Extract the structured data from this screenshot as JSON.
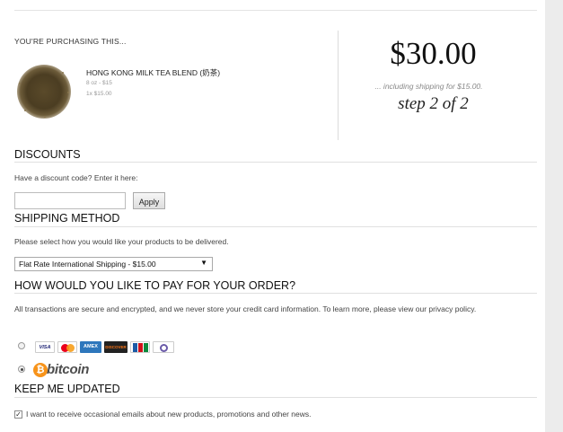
{
  "summary": {
    "heading": "YOU'RE PURCHASING THIS...",
    "product_name": "HONG KONG MILK TEA BLEND (奶茶)",
    "variant": "8 oz - $15",
    "quantity": "1x $15.00",
    "total": "$30.00",
    "shipping_note": "... including shipping for $15.00.",
    "step": "step 2 of 2"
  },
  "discounts": {
    "title": "DISCOUNTS",
    "prompt": "Have a discount code? Enter it here:",
    "input_value": "",
    "apply_label": "Apply"
  },
  "shipping": {
    "title": "SHIPPING METHOD",
    "prompt": "Please select how you would like your products to be delivered.",
    "selected_option": "Flat Rate International Shipping - $15.00"
  },
  "payment": {
    "title": "HOW WOULD YOU LIKE TO PAY FOR YOUR ORDER?",
    "note": "All transactions are secure and encrypted, and we never store your credit card information. To learn more, please view our privacy policy.",
    "options": [
      {
        "id": "credit-card",
        "selected": false,
        "cards": [
          "VISA",
          "MasterCard",
          "AMEX",
          "DISCOVER",
          "JCB",
          "Diners Club"
        ]
      },
      {
        "id": "bitcoin",
        "selected": true,
        "label": "bitcoin",
        "symbol": "₿"
      }
    ],
    "card_colors": {
      "visa": "#1a1f71",
      "mastercard_red": "#eb001b",
      "mastercard_yellow": "#f79e1b",
      "amex": "#2e77bc",
      "discover": "#f47216",
      "jcb_red": "#d0121b",
      "diners": "#6a5aa8"
    },
    "bitcoin_color": "#f7931a"
  },
  "updates": {
    "title": "KEEP ME UPDATED",
    "checkbox_label": "I want to receive occasional emails about new products, promotions and other news.",
    "checked": true
  }
}
